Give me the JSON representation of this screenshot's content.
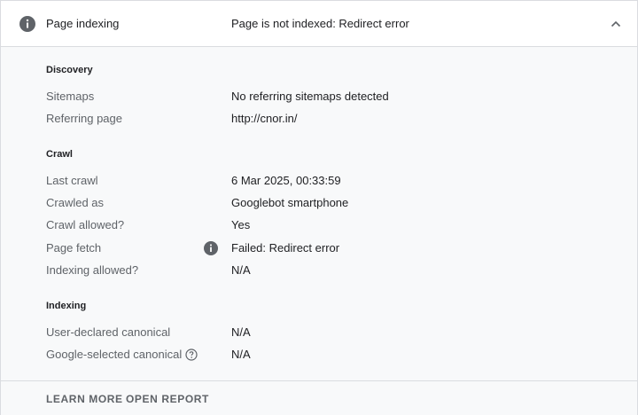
{
  "header": {
    "title": "Page indexing",
    "status": "Page is not indexed: Redirect error"
  },
  "sections": {
    "discovery": {
      "title": "Discovery",
      "rows": [
        {
          "label": "Sitemaps",
          "value": "No referring sitemaps detected"
        },
        {
          "label": "Referring page",
          "value": "http://cnor.in/"
        }
      ]
    },
    "crawl": {
      "title": "Crawl",
      "rows": [
        {
          "label": "Last crawl",
          "value": "6 Mar 2025, 00:33:59"
        },
        {
          "label": "Crawled as",
          "value": "Googlebot smartphone"
        },
        {
          "label": "Crawl allowed?",
          "value": "Yes"
        },
        {
          "label": "Page fetch",
          "value": "Failed: Redirect error"
        },
        {
          "label": "Indexing allowed?",
          "value": "N/A"
        }
      ]
    },
    "indexing": {
      "title": "Indexing",
      "rows": [
        {
          "label": "User-declared canonical",
          "value": "N/A"
        },
        {
          "label": "Google-selected canonical",
          "value": "N/A"
        }
      ]
    }
  },
  "footer": {
    "learn_more": "LEARN MORE",
    "open_report": "OPEN REPORT"
  },
  "colors": {
    "icon_gray": "#5f6368",
    "text": "#202124",
    "secondary_text": "#5f6368",
    "panel_bg": "#f8f9fa",
    "border": "#dadce0"
  },
  "icons": {
    "header_status": "info-icon",
    "collapse": "chevron-up-icon",
    "page_fetch_status": "info-icon",
    "canonical_help": "help-circle-icon"
  }
}
